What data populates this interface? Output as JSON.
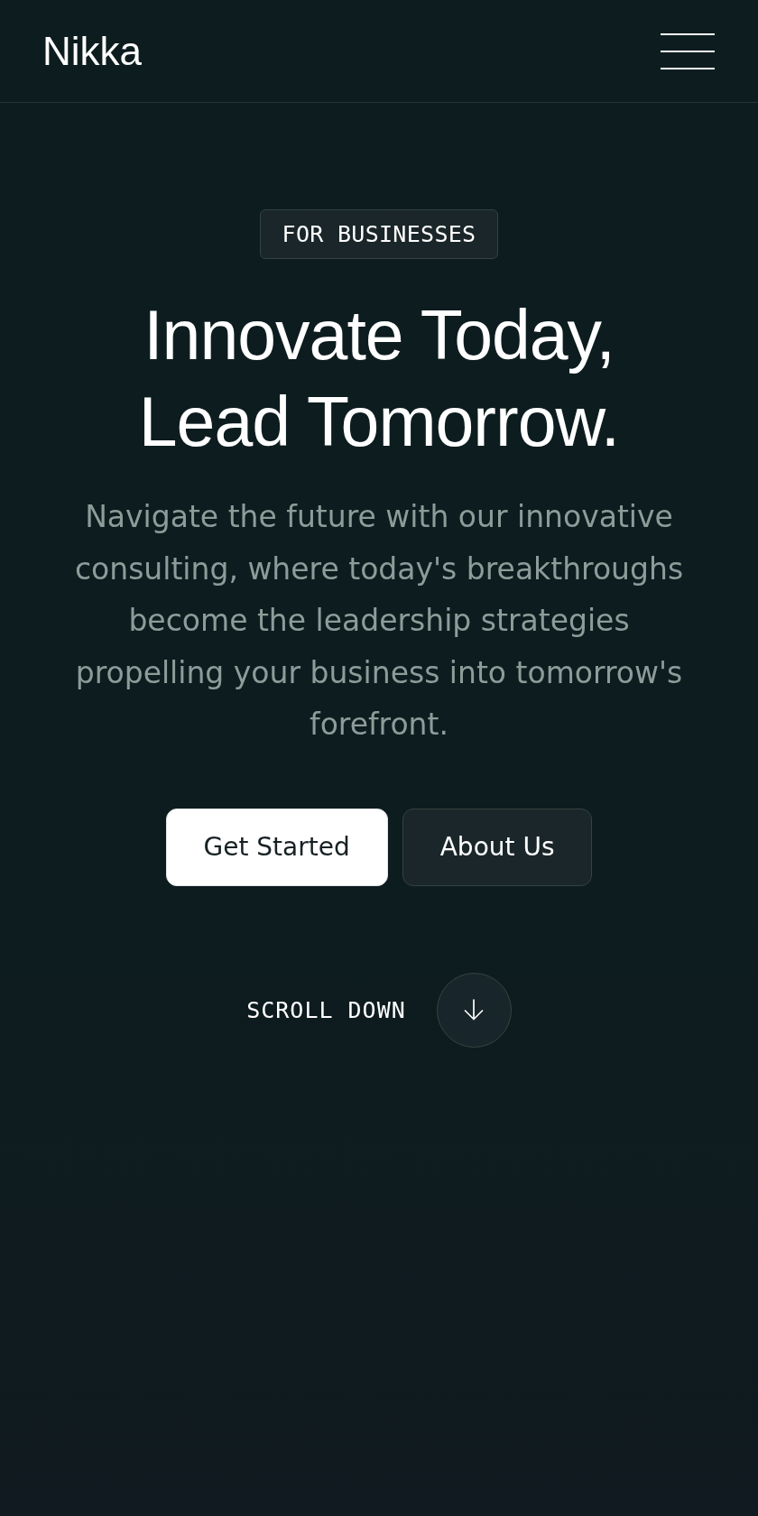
{
  "header": {
    "logo": "Nikka"
  },
  "hero": {
    "badge": "FOR BUSINESSES",
    "title": "Innovate Today, Lead Tomorrow.",
    "description": "Navigate the future with our innovative consulting, where today's breakthroughs become the leadership strategies propelling your business into tomorrow's forefront.",
    "buttons": [
      {
        "label": "Get Started",
        "kind": "primary"
      },
      {
        "label": "About Us",
        "kind": "secondary"
      }
    ],
    "scroll": {
      "label": "SCROLL DOWN"
    }
  }
}
